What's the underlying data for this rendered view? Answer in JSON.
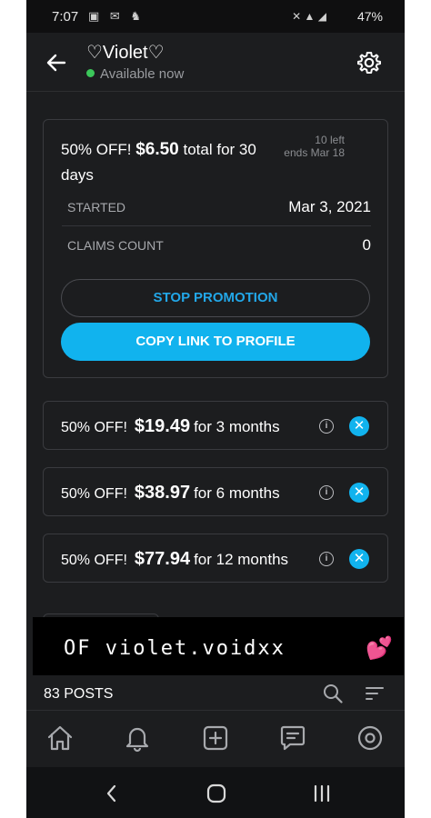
{
  "status_bar": {
    "time": "7:07",
    "battery": "47%"
  },
  "header": {
    "name": "♡Violet♡",
    "availability": "Available now"
  },
  "promotion": {
    "title_prefix": "50% OFF!",
    "title_price": "$6.50",
    "title_suffix": "total for 30 days",
    "claims_left": "10 left",
    "ends": "ends Mar 18",
    "started_label": "STARTED",
    "started_value": "Mar 3, 2021",
    "claims_label": "CLAIMS COUNT",
    "claims_value": "0",
    "stop_button": "STOP PROMOTION",
    "copy_button": "COPY LINK TO PROFILE"
  },
  "discounts": [
    {
      "prefix": "50% OFF!",
      "price": "$19.49",
      "period": "for 3 months"
    },
    {
      "prefix": "50% OFF!",
      "price": "$38.97",
      "period": "for 6 months"
    },
    {
      "prefix": "50% OFF!",
      "price": "$77.94",
      "period": "for 12 months"
    }
  ],
  "overlay": {
    "text": "OF violet.voidxx"
  },
  "posts": {
    "count": "83 POSTS"
  },
  "colors": {
    "accent": "#11b3ee",
    "online": "#3bc75a",
    "background": "#1c1d1f"
  }
}
